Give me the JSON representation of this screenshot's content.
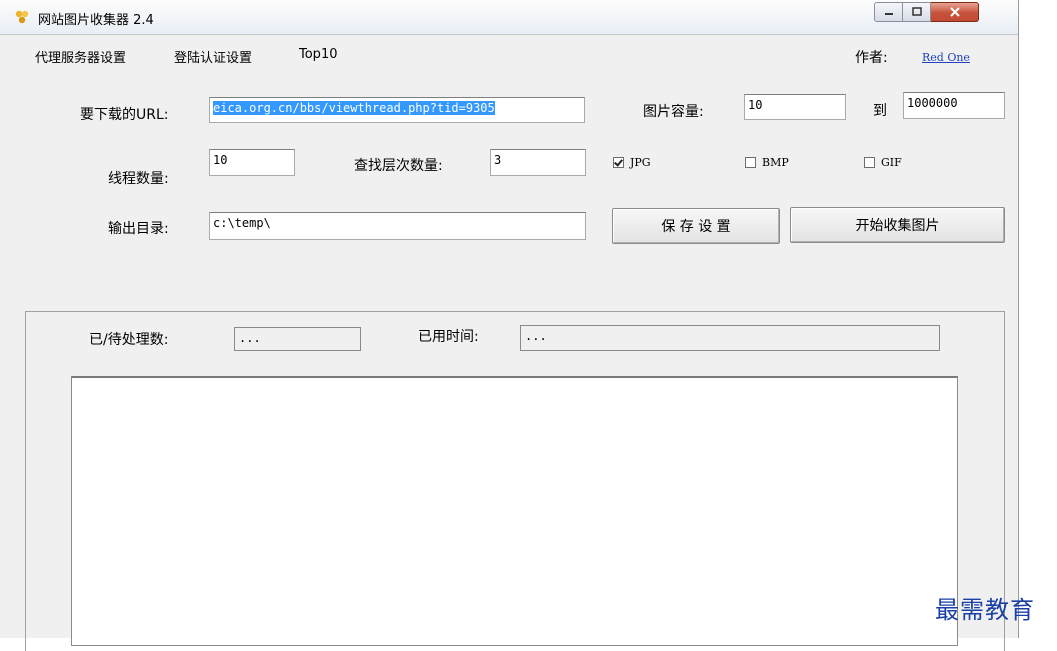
{
  "window": {
    "title": "网站图片收集器 2.4"
  },
  "menu": {
    "items": [
      "代理服务器设置",
      "登陆认证设置",
      "Top10"
    ]
  },
  "author": {
    "label": "作者:",
    "name": "Red One"
  },
  "url": {
    "label": "要下载的URL:",
    "value": "eica.org.cn/bbs/viewthread.php?tid=9305"
  },
  "size": {
    "label": "图片容量:",
    "min": "10",
    "to_label": "到",
    "max": "1000000"
  },
  "threads": {
    "label": "线程数量:",
    "value": "10"
  },
  "depth": {
    "label": "查找层次数量:",
    "value": "3"
  },
  "filetypes": [
    {
      "label": "JPG",
      "checked": true
    },
    {
      "label": "BMP",
      "checked": false
    },
    {
      "label": "GIF",
      "checked": false
    }
  ],
  "output": {
    "label": "输出目录:",
    "value": "c:\\temp\\"
  },
  "buttons": {
    "save": "保 存 设 置",
    "start": "开始收集图片"
  },
  "progress": {
    "processed_label": "已/待处理数:",
    "processed_value": "...",
    "elapsed_label": "已用时间:",
    "elapsed_value": "..."
  },
  "watermark": "最需教育",
  "colors": {
    "link": "#1f3fbf",
    "selection": "#3399ff",
    "close_button": "#c7533c",
    "watermark": "#1a3fa6"
  }
}
